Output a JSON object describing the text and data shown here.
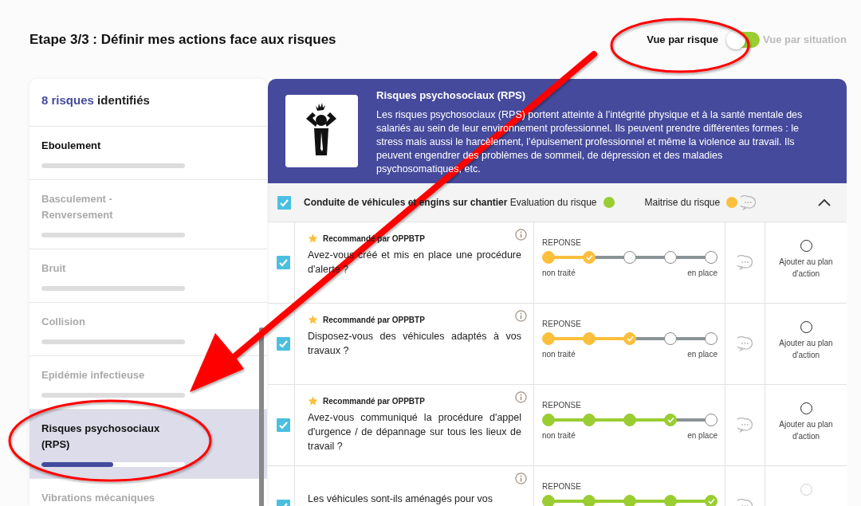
{
  "page_title": "Etape 3/3 : Définir mes actions face aux risques",
  "view_toggle": {
    "left_label": "Vue par risque",
    "right_label": "Vue par situation",
    "on": false
  },
  "sidebar": {
    "count": "8 risques",
    "count_label": "identifiés",
    "items": [
      {
        "label": "Eboulement",
        "disabled": false,
        "selected": false,
        "level": 0
      },
      {
        "label": "Basculement - Renversement",
        "disabled": true,
        "selected": false,
        "level": 0
      },
      {
        "label": "Bruit",
        "disabled": true,
        "selected": false,
        "level": 0
      },
      {
        "label": "Collision",
        "disabled": true,
        "selected": false,
        "level": 0
      },
      {
        "label": "Epidémie infectieuse",
        "disabled": true,
        "selected": false,
        "level": 0
      },
      {
        "label": "Risques psychosociaux (RPS)",
        "disabled": false,
        "selected": true,
        "level": 0.5
      },
      {
        "label": "Vibrations mécaniques",
        "disabled": true,
        "selected": false
      }
    ]
  },
  "risk": {
    "title": "Risques psychosociaux (RPS)",
    "description": "Les risques psychosociaux (RPS) portent atteinte à l’intégrité physique et à la santé mentale des salariés au sein de leur environnement professionnel. Ils peuvent prendre différentes formes : le stress mais aussi le harcèlement, l’épuisement professionnel et même la violence au travail. Ils peuvent engendrer des problèmes de sommeil, de dépression et des maladies psychosomatiques, etc."
  },
  "situation": {
    "checked": true,
    "title": "Conduite de véhicules et engins sur chantier",
    "evaluation": {
      "label": "Evaluation du risque",
      "color": "#9acd32"
    },
    "control": {
      "label": "Maitrise du risque",
      "color": "#fbbf3c"
    },
    "expanded": true
  },
  "questions": [
    {
      "checked": true,
      "recommended": true,
      "badge": "Recommandé par OPPBTP",
      "text": "Avez-vous créé et mis en place une procédure d'alerte ?",
      "scale_label": "REPONSE",
      "low_label": "non traité",
      "high_label": "en place",
      "level": 0.25,
      "color": "#fbbf3c",
      "action_label": "Ajouter au plan d'action",
      "action_disabled": false
    },
    {
      "checked": true,
      "recommended": true,
      "badge": "Recommandé par OPPBTP",
      "text": "Disposez-vous des véhicules adaptés à vos travaux ?",
      "scale_label": "REPONSE",
      "low_label": "non traité",
      "high_label": "en place",
      "level": 0.5,
      "color": "#fbbf3c",
      "action_label": "Ajouter au plan d'action",
      "action_disabled": false
    },
    {
      "checked": true,
      "recommended": true,
      "badge": "Recommandé par OPPBTP",
      "text": "Avez-vous communiqué la procédure d'appel d'urgence / de dépannage sur tous les lieux de travail ?",
      "scale_label": "REPONSE",
      "low_label": "non traité",
      "high_label": "en place",
      "level": 0.75,
      "color": "#9acd32",
      "action_label": "Ajouter au plan d'action",
      "action_disabled": false
    },
    {
      "checked": true,
      "recommended": false,
      "text": "Les véhicules sont-ils aménagés pour vos",
      "scale_label": "REPONSE",
      "level": 1,
      "color": "#9acd32",
      "action_disabled": true
    }
  ]
}
